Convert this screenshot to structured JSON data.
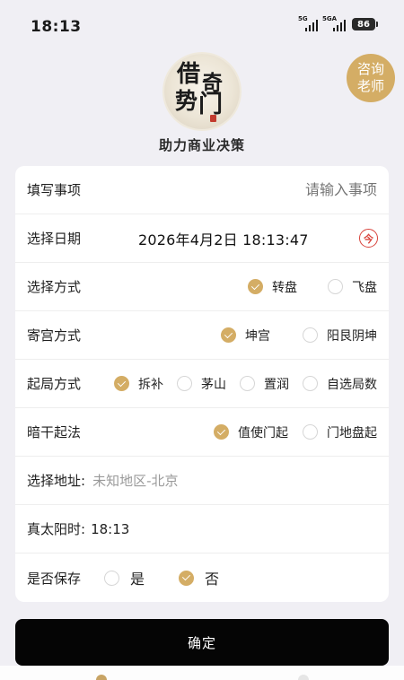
{
  "status": {
    "time": "18:13",
    "signal1": "5G",
    "signal2": "5GA",
    "battery": "86"
  },
  "header": {
    "logo_chars": [
      "借",
      "奇",
      "势",
      "门"
    ],
    "subtitle": "助力商业决策",
    "consult_line1": "咨询",
    "consult_line2": "老师"
  },
  "form": {
    "matter": {
      "label": "填写事项",
      "placeholder": "请输入事项"
    },
    "date": {
      "label": "选择日期",
      "value": "2026年4月2日 18:13:47",
      "today_icon": "今"
    },
    "method": {
      "label": "选择方式",
      "options": [
        "转盘",
        "飞盘"
      ],
      "selected": "转盘"
    },
    "palace": {
      "label": "寄宫方式",
      "options": [
        "坤宫",
        "阳艮阴坤"
      ],
      "selected": "坤宫"
    },
    "start": {
      "label": "起局方式",
      "options": [
        "拆补",
        "茅山",
        "置润",
        "自选局数"
      ],
      "selected": "拆补"
    },
    "hidden_stem": {
      "label": "暗干起法",
      "options": [
        "值使门起",
        "门地盘起"
      ],
      "selected": "值使门起"
    },
    "address": {
      "label": "选择地址:",
      "value": "未知地区-北京"
    },
    "solar_time": {
      "label": "真太阳时:",
      "value": "18:13"
    },
    "save": {
      "label": "是否保存",
      "options": [
        "是",
        "否"
      ],
      "selected": "否"
    }
  },
  "confirm_label": "确定",
  "colors": {
    "accent": "#d4ad65",
    "today_red": "#d8423a",
    "background": "#f0eff4",
    "button": "#050505"
  },
  "icons": [
    "signal-icon",
    "battery-icon",
    "logo-seal",
    "calendar-today-icon",
    "radio-check-icon"
  ]
}
